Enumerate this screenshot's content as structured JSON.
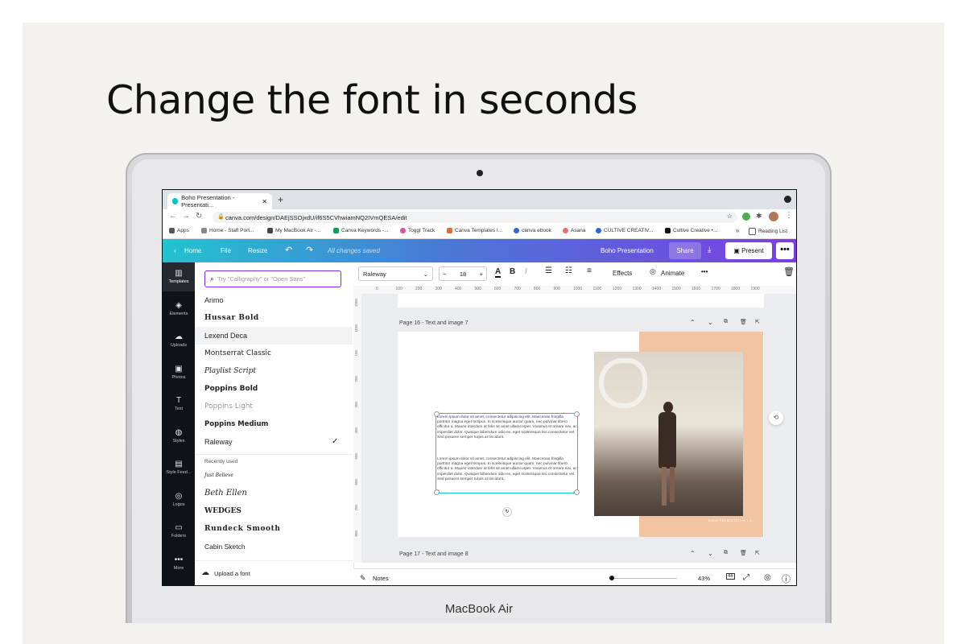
{
  "headline": "Change the font in seconds",
  "device_label": "MacBook Air",
  "browser": {
    "tab_title": "Boho Presentation - Presentati...",
    "url": "canva.com/design/DAEjSSOjxdU/if6S5CVhwiamNQ2IVmQESA/edit",
    "bookmarks": [
      "Apps",
      "Home - Staff Port...",
      "My MacBook Air -...",
      "Canva Keywords -...",
      "Toggl Track",
      "Canva Templates I...",
      "canva ebook",
      "Asana",
      "CULTIVE CREATIV...",
      "Cultive Creative •...",
      "Reading List"
    ]
  },
  "editor_header": {
    "home": "Home",
    "file": "File",
    "resize": "Resize",
    "saved_status": "All changes saved",
    "design_title": "Boho Presentation",
    "share": "Share",
    "present": "Present",
    "more": "•••"
  },
  "sidebar": [
    "Templates",
    "Elements",
    "Uploads",
    "Photos",
    "Text",
    "Styles",
    "Style Feed...",
    "Logos",
    "Folders",
    "More"
  ],
  "font_panel": {
    "search_placeholder": "Try \"Calligraphy\" or \"Open Sans\"",
    "fonts": [
      "Arimo",
      "Hussar Bold",
      "Lexend Deca",
      "Montserrat Classic",
      "Playlist Script",
      "Poppins Bold",
      "Poppins Light",
      "Poppins Medium",
      "Raleway"
    ],
    "selected_font": "Raleway",
    "recent_heading": "Recently used",
    "recent_fonts": [
      "Just Believe",
      "Beth Ellen",
      "WEDGES",
      "Rundeck Smooth",
      "Cabin Sketch"
    ],
    "upload_label": "Upload a font"
  },
  "toolbar": {
    "font": "Raleway",
    "size": "18",
    "effects": "Effects",
    "animate": "Animate"
  },
  "ruler_ticks": [
    "0",
    "100",
    "200",
    "300",
    "400",
    "500",
    "600",
    "700",
    "800",
    "900",
    "1000",
    "1100",
    "1200",
    "1300",
    "1400",
    "1500",
    "1600",
    "1700",
    "1800",
    "1900"
  ],
  "ruler_left_ticks": [
    "1000",
    "1100",
    "100",
    "200",
    "300",
    "400",
    "500",
    "600",
    "700",
    "800"
  ],
  "pages": {
    "page16": "Page 16 - Text and image 7",
    "page17": "Page 17 - Text and image 8"
  },
  "slide": {
    "paragraph1": "Lorem ipsum dolor sit amet, consectetur adipiscing elit. Maecenas fringilla porttitor magna eget tempus. In scelerisque auctor quam, nec pulvinar libero efficitur a. Mauris interdum at felis sit amet ullamcorper. Vivamus et ornare nisi, ac imperdiet dolor. Quisque bibendum odio ex, eget scelerisque leo consectetur vel. Sed posuere semper turpis at tincidunt.",
    "paragraph2": "Lorem ipsum dolor sit amet, consectetur adipiscing elit. Maecenas fringilla porttitor magna eget tempus. In scelerisque auctor quam, nec pulvinar libero efficitur a. Mauris interdum at felis sit amet ullamcorper. Vivamus et ornare nisi, ac imperdiet dolor. Quisque bibendum odio ex, eget scelerisque leo consectetur vel. Sed posuere semper turpis at tincidunt.",
    "footer_mark": "BOHO PRESENTATION • 01"
  },
  "bottom_bar": {
    "notes": "Notes",
    "zoom": "43%",
    "page_count": "48",
    "zoom_fraction": 0.03
  },
  "colors": {
    "accent": "#7d2ae8",
    "header_start": "#22c3cf",
    "header_end": "#7c3ee0",
    "peach": "#f2c4a1",
    "selection": "#13c3cc"
  }
}
